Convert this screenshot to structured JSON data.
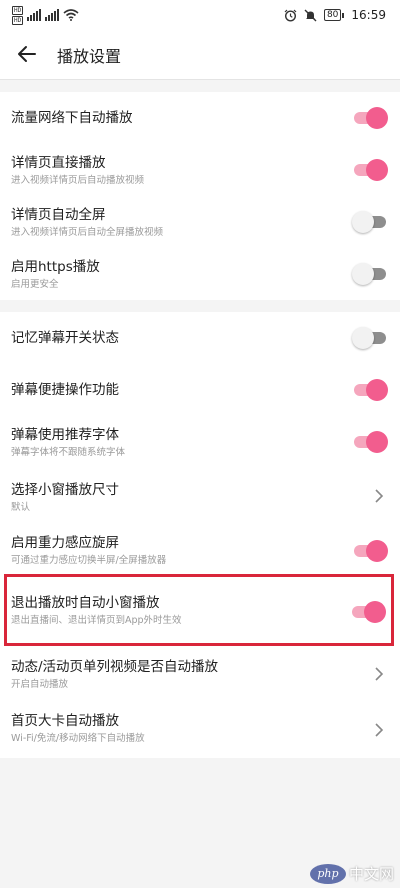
{
  "status_bar": {
    "sim1": "HD",
    "sim2": "HD",
    "battery": "80",
    "time": "16:59"
  },
  "header": {
    "title": "播放设置"
  },
  "groups": [
    {
      "items": [
        {
          "label": "流量网络下自动播放",
          "sub": "",
          "control": "toggle",
          "on": true
        },
        {
          "label": "详情页直接播放",
          "sub": "进入视频详情页后自动播放视频",
          "control": "toggle",
          "on": true
        },
        {
          "label": "详情页自动全屏",
          "sub": "进入视频详情页后自动全屏播放视频",
          "control": "toggle",
          "on": false
        },
        {
          "label": "启用https播放",
          "sub": "启用更安全",
          "control": "toggle",
          "on": false
        }
      ]
    },
    {
      "items": [
        {
          "label": "记忆弹幕开关状态",
          "sub": "",
          "control": "toggle",
          "on": false
        },
        {
          "label": "弹幕便捷操作功能",
          "sub": "",
          "control": "toggle",
          "on": true
        },
        {
          "label": "弹幕使用推荐字体",
          "sub": "弹幕字体将不跟随系统字体",
          "control": "toggle",
          "on": true
        }
      ]
    },
    {
      "items": [
        {
          "label": "选择小窗播放尺寸",
          "sub": "默认",
          "control": "chevron"
        },
        {
          "label": "启用重力感应旋屏",
          "sub": "可通过重力感应切换半屏/全屏播放器",
          "control": "toggle",
          "on": true
        },
        {
          "label": "退出播放时自动小窗播放",
          "sub": "退出直播间、退出详情页到App外时生效",
          "control": "toggle",
          "on": true,
          "highlighted": true
        },
        {
          "label": "动态/活动页单列视频是否自动播放",
          "sub": "开启自动播放",
          "control": "chevron"
        },
        {
          "label": "首页大卡自动播放",
          "sub": "Wi-Fi/免流/移动网络下自动播放",
          "control": "chevron"
        }
      ]
    }
  ],
  "colors": {
    "accent": "#f25d8e",
    "accent_track": "#f5a6bd",
    "highlight_border": "#d9263a"
  },
  "watermark": {
    "logo": "php",
    "text": "中文网"
  }
}
